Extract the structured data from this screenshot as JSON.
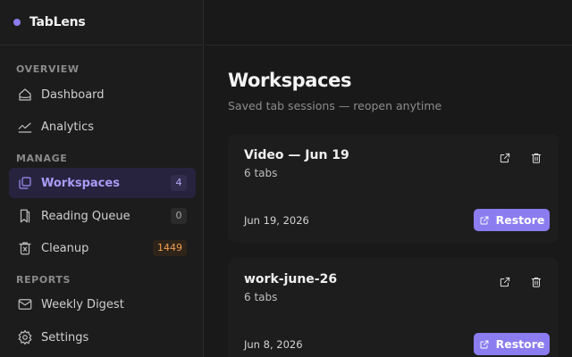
{
  "app": {
    "name": "TabLens",
    "accent": "#8b7cf0"
  },
  "sidebar": {
    "sections": [
      {
        "label": "OVERVIEW"
      },
      {
        "label": "MANAGE"
      },
      {
        "label": "REPORTS"
      }
    ],
    "items": [
      {
        "label": "Dashboard",
        "icon": "home-icon"
      },
      {
        "label": "Analytics",
        "icon": "chart-line-icon"
      },
      {
        "label": "Workspaces",
        "icon": "copy-stack-icon",
        "badge": "4",
        "active": true
      },
      {
        "label": "Reading Queue",
        "icon": "bookmark-icon",
        "badge": "0"
      },
      {
        "label": "Cleanup",
        "icon": "trash-icon",
        "badge": "1449",
        "badge_color": "#f0a050"
      },
      {
        "label": "Weekly Digest",
        "icon": "mail-icon"
      },
      {
        "label": "Settings",
        "icon": "gear-icon"
      }
    ]
  },
  "main": {
    "title": "Workspaces",
    "subtitle": "Saved tab sessions — reopen anytime",
    "workspaces": [
      {
        "name": "Video — Jun 19",
        "tabs": "6 tabs",
        "date": "Jun 19, 2026",
        "restore_label": "Restore"
      },
      {
        "name": "work-june-26",
        "tabs": "6 tabs",
        "date": "Jun 8, 2026",
        "restore_label": "Restore"
      }
    ]
  }
}
